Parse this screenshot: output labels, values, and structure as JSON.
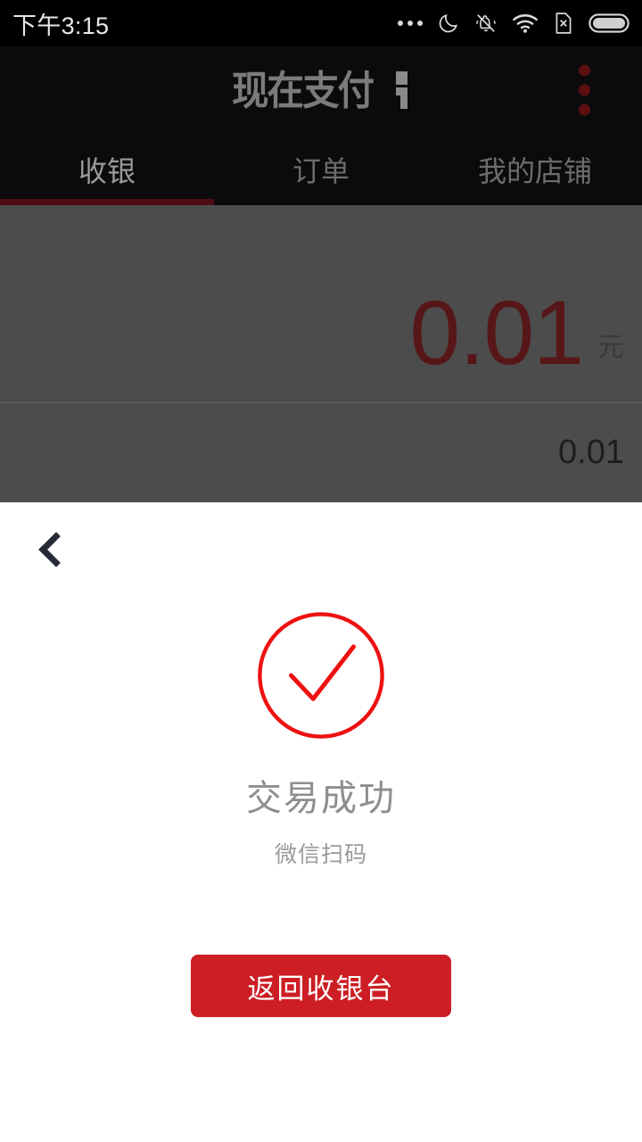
{
  "status_bar": {
    "time": "下午3:15",
    "icons": [
      "more-dots-icon",
      "do-not-disturb-moon-icon",
      "silent-bell-icon",
      "wifi-icon",
      "no-sim-card-icon",
      "battery-full-icon"
    ]
  },
  "app_bar": {
    "logo_text": "现在支付",
    "overflow_menu_label": "更多",
    "overflow_color": "#5c0f10"
  },
  "tabs": {
    "items": [
      {
        "label": "收银",
        "active": true
      },
      {
        "label": "订单",
        "active": false
      },
      {
        "label": "我的店铺",
        "active": false
      }
    ],
    "active_indicator_color": "#4c0c11"
  },
  "cashier": {
    "amount": "0.01",
    "currency_unit": "元",
    "subtotal": "0.01",
    "amount_color": "#571618",
    "overlay_color": "#4c4c4c"
  },
  "result_sheet": {
    "back_label": "返回",
    "status_icon": "check-circle-icon",
    "status_color": "#ee1111",
    "title": "交易成功",
    "subtitle": "微信扫码",
    "primary_button": "返回收银台",
    "primary_button_color": "#cc1e24"
  }
}
